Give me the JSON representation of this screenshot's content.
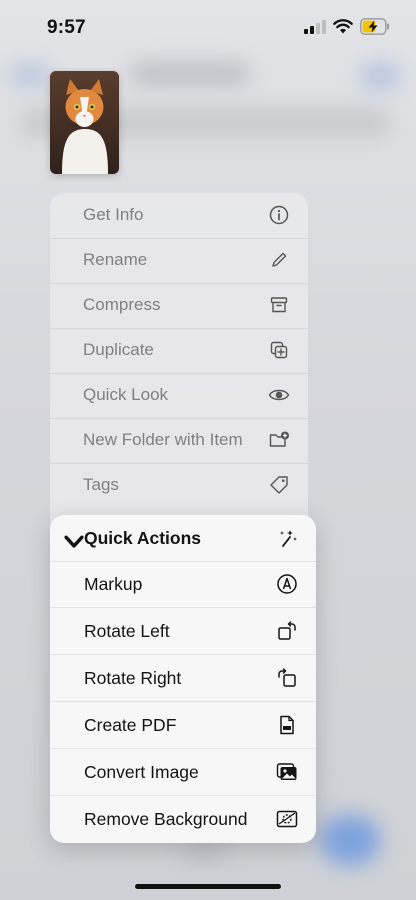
{
  "status_bar": {
    "time": "9:57"
  },
  "menu": {
    "items": [
      {
        "label": "Get Info",
        "icon": "info-icon"
      },
      {
        "label": "Rename",
        "icon": "pencil-icon"
      },
      {
        "label": "Compress",
        "icon": "archive-box-icon"
      },
      {
        "label": "Duplicate",
        "icon": "duplicate-icon"
      },
      {
        "label": "Quick Look",
        "icon": "eye-icon"
      },
      {
        "label": "New Folder with Item",
        "icon": "folder-add-icon"
      },
      {
        "label": "Tags",
        "icon": "tag-icon"
      }
    ]
  },
  "quick_actions": {
    "title": "Quick Actions",
    "items": [
      {
        "label": "Markup",
        "icon": "markup-pen-icon"
      },
      {
        "label": "Rotate Left",
        "icon": "rotate-left-icon"
      },
      {
        "label": "Rotate Right",
        "icon": "rotate-right-icon"
      },
      {
        "label": "Create PDF",
        "icon": "pdf-doc-icon"
      },
      {
        "label": "Convert Image",
        "icon": "photo-icon"
      },
      {
        "label": "Remove Background",
        "icon": "remove-background-icon"
      }
    ]
  },
  "colors": {
    "accent": "#f5c400",
    "text": "#141414",
    "dim_text": "#7f7f84"
  }
}
